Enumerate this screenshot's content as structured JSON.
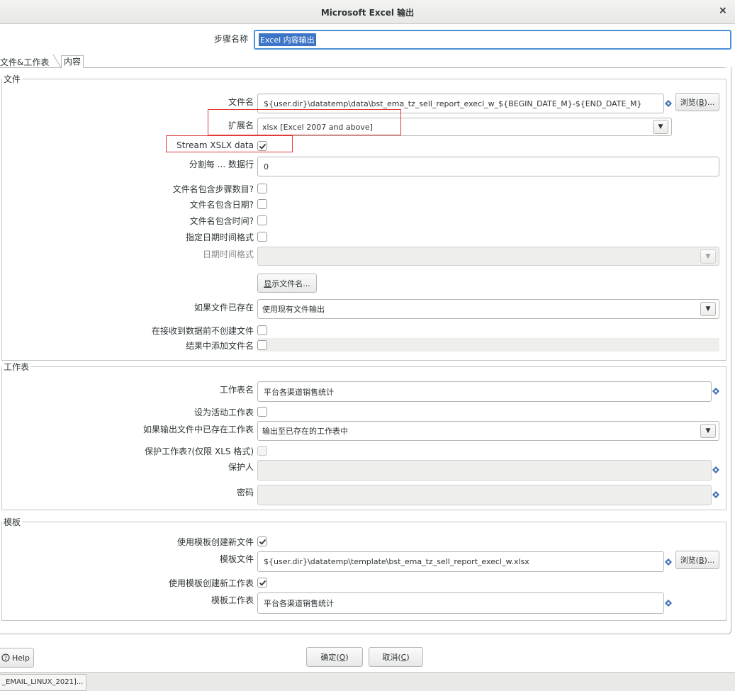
{
  "window": {
    "title": "Microsoft Excel 输出",
    "close": "×"
  },
  "step": {
    "label": "步骤名称",
    "value": "Excel 内容输出"
  },
  "tabs": [
    {
      "label": "文件&工作表"
    },
    {
      "label": "内容"
    }
  ],
  "file_section": {
    "legend": "文件",
    "filename_label": "文件名",
    "filename_value": "${user.dir}\\datatemp\\data\\bst_ema_tz_sell_report_execl_w_${BEGIN_DATE_M}-${END_DATE_M}",
    "browse_label": "浏览(B)...",
    "browse_prefix": "浏览(",
    "browse_key": "B",
    "browse_suffix": ")...",
    "extension_label": "扩展名",
    "extension_value": "xlsx [Excel 2007 and above]",
    "stream_label": "Stream XSLX data",
    "stream_checked": true,
    "split_label": "分割每 ... 数据行",
    "split_value": "0",
    "include_stepnr_label": "文件名包含步骤数目?",
    "include_date_label": "文件名包含日期?",
    "include_time_label": "文件名包含时间?",
    "specify_format_label": "指定日期时间格式",
    "date_format_label": "日期时间格式",
    "show_filename_button": "显示文件名...",
    "show_filename_key": "显",
    "show_filename_rest": "示文件名...",
    "if_exists_label": "如果文件已存在",
    "if_exists_value": "使用现有文件输出",
    "no_create_label": "在接收到数据前不创建文件",
    "add_to_result_label": "结果中添加文件名"
  },
  "sheet_section": {
    "legend": "工作表",
    "sheet_name_label": "工作表名",
    "sheet_name_value": "平台各渠道销售统计",
    "make_active_label": "设为活动工作表",
    "if_sheet_exists_label": "如果输出文件中已存在工作表",
    "if_sheet_exists_value": "输出至已存在的工作表中",
    "protect_label": "保护工作表?(仅限 XLS 格式)",
    "protected_by_label": "保护人",
    "password_label": "密码"
  },
  "template_section": {
    "legend": "模板",
    "use_template_file_label": "使用模板创建新文件",
    "use_template_file_checked": true,
    "template_file_label": "模板文件",
    "template_file_value": "${user.dir}\\datatemp\\template\\bst_ema_tz_sell_report_execl_w.xlsx",
    "browse_label": "浏览(B)...",
    "use_template_sheet_label": "使用模板创建新工作表",
    "use_template_sheet_checked": true,
    "template_sheet_label": "模板工作表",
    "template_sheet_value": "平台各渠道销售统计"
  },
  "footer": {
    "help": "Help",
    "ok_prefix": "确定(",
    "ok_key": "O",
    "ok_suffix": ")",
    "cancel_prefix": "取消(",
    "cancel_key": "C",
    "cancel_suffix": ")"
  },
  "taskbar": {
    "item": "_EMAIL_LINUX_2021]..."
  },
  "colors": {
    "highlight_box": "#e03a3a",
    "selection": "#3c74c7",
    "focus": "#4a90d9",
    "var_icon": "#3b6fb6"
  }
}
